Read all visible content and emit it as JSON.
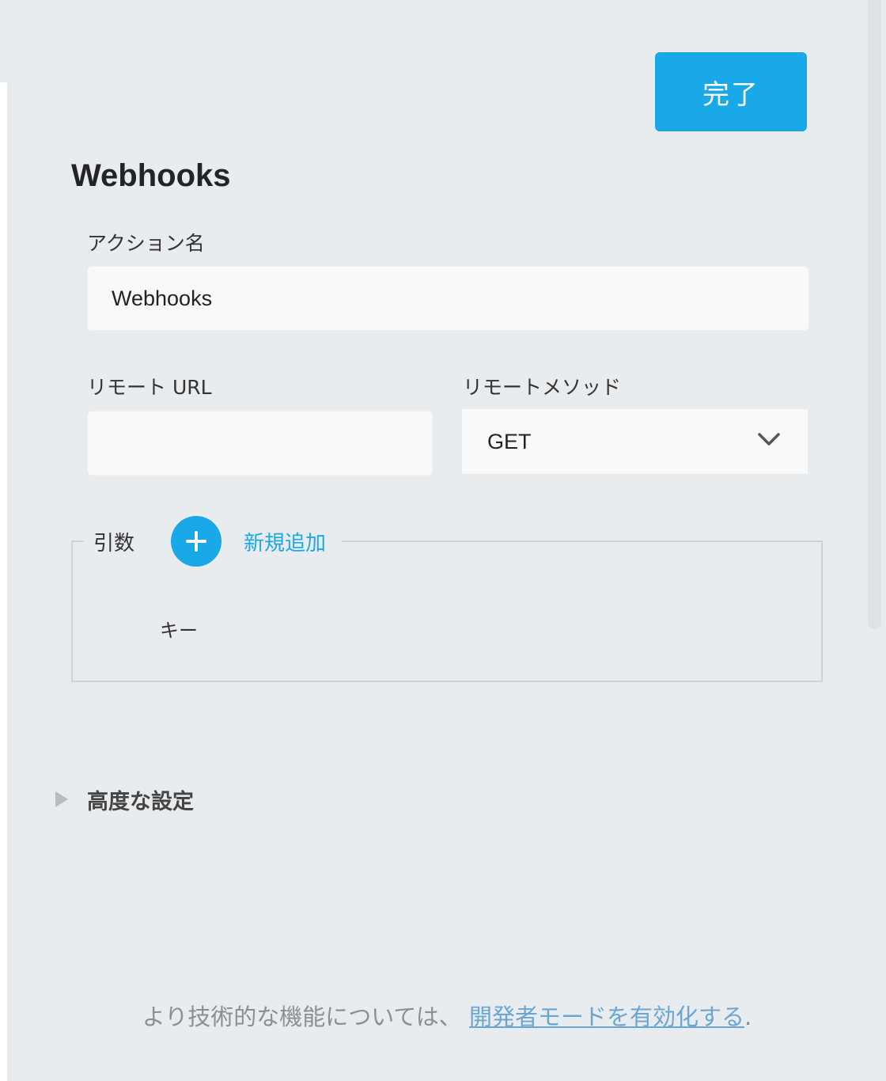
{
  "header": {
    "done_label": "完了"
  },
  "page": {
    "title": "Webhooks"
  },
  "form": {
    "action_name_label": "アクション名",
    "action_name_value": "Webhooks",
    "remote_url_label": "リモート URL",
    "remote_url_value": "",
    "remote_method_label": "リモートメソッド",
    "remote_method_value": "GET"
  },
  "arguments": {
    "label": "引数",
    "add_new_label": "新規追加",
    "key_column": "キー"
  },
  "advanced": {
    "label": "高度な設定",
    "expanded": false
  },
  "footer": {
    "text": "より技術的な機能については、 ",
    "link_label": "開発者モードを有効化する",
    "suffix": "."
  },
  "icons": {
    "add": "plus-icon",
    "method_dropdown": "chevron-down-icon",
    "advanced_toggle": "triangle-right-icon"
  },
  "colors": {
    "accent": "#1aa9e8",
    "background": "#e9ecee",
    "input_bg": "#f9f9f9",
    "link_muted": "#6aa6d4"
  }
}
